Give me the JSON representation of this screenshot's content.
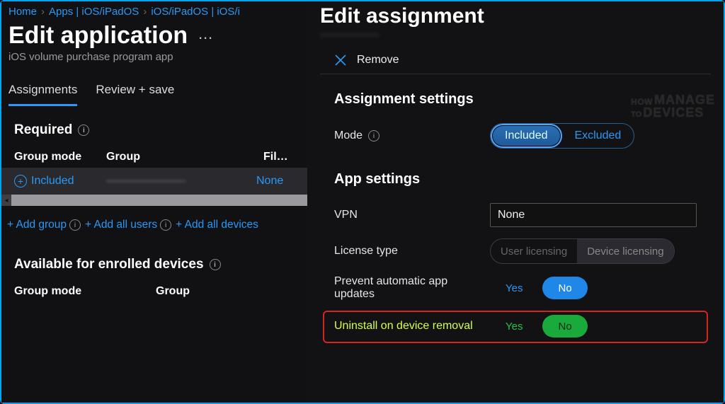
{
  "breadcrumb": {
    "home": "Home",
    "apps": "Apps | iOS/iPadOS",
    "ios": "iOS/iPadOS | iOS/i"
  },
  "left": {
    "title": "Edit application",
    "subtitle": "iOS volume purchase program app",
    "tabs": {
      "assignments": "Assignments",
      "review": "Review + save"
    },
    "required": "Required",
    "cols": {
      "mode": "Group mode",
      "group": "Group",
      "filter": "Fil…"
    },
    "row": {
      "mode": "Included",
      "group": "———————",
      "filter": "None"
    },
    "links": {
      "addGroup": "+ Add group",
      "addUsers": "+ Add all users",
      "addDevices": "+ Add all devices"
    },
    "available": "Available for enrolled devices",
    "cols2": {
      "mode": "Group mode",
      "group": "Group"
    }
  },
  "right": {
    "title": "Edit assignment",
    "remove": "Remove",
    "sections": {
      "assign": "Assignment settings",
      "app": "App settings"
    },
    "mode": {
      "label": "Mode",
      "included": "Included",
      "excluded": "Excluded"
    },
    "vpn": {
      "label": "VPN",
      "value": "None"
    },
    "license": {
      "label": "License type",
      "user": "User licensing",
      "device": "Device licensing"
    },
    "prevent": {
      "label": "Prevent automatic app updates",
      "yes": "Yes",
      "no": "No"
    },
    "uninstall": {
      "label": "Uninstall on device removal",
      "yes": "Yes",
      "no": "No"
    }
  },
  "logo": {
    "how": "HOW",
    "to": "TO",
    "manage": "MANAGE",
    "devices": "DEVICES"
  }
}
